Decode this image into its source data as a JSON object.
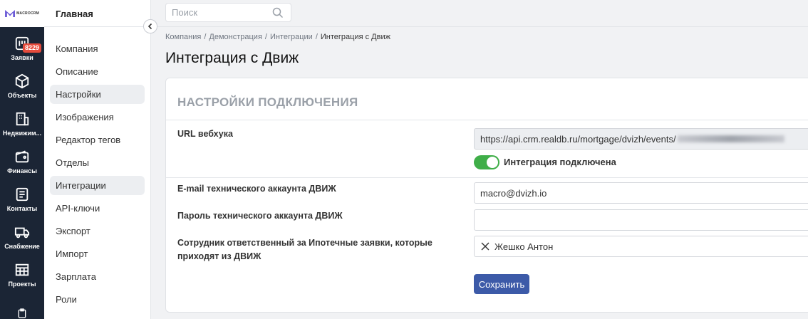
{
  "logo": {
    "text": "MACROCRM"
  },
  "rail": [
    {
      "label": "Заявки",
      "icon": "requests-icon",
      "badge": "8229"
    },
    {
      "label": "Объекты",
      "icon": "cube-icon"
    },
    {
      "label": "Недвижим...",
      "icon": "building-icon"
    },
    {
      "label": "Финансы",
      "icon": "wallet-icon"
    },
    {
      "label": "Контакты",
      "icon": "contacts-icon"
    },
    {
      "label": "Снабжение",
      "icon": "truck-icon"
    },
    {
      "label": "Проекты",
      "icon": "projects-icon"
    }
  ],
  "sidebar": {
    "title": "Главная",
    "items": [
      {
        "label": "Компания"
      },
      {
        "label": "Описание"
      },
      {
        "label": "Настройки",
        "active": true
      },
      {
        "label": "Изображения"
      },
      {
        "label": "Редактор тегов"
      },
      {
        "label": "Отделы"
      },
      {
        "label": "Интеграции",
        "active": true
      },
      {
        "label": "API-ключи"
      },
      {
        "label": "Экспорт"
      },
      {
        "label": "Импорт"
      },
      {
        "label": "Зарплата"
      },
      {
        "label": "Роли"
      }
    ]
  },
  "search": {
    "placeholder": "Поиск"
  },
  "breadcrumb": [
    "Компания",
    "Демонстрация",
    "Интеграции",
    "Интеграция с Движ"
  ],
  "page_title": "Интеграция с Движ",
  "section_title": "НАСТРОЙКИ ПОДКЛЮЧЕНИЯ",
  "form": {
    "webhook_label": "URL вебхука",
    "webhook_value": "https://api.crm.realdb.ru/mortgage/dvizh/events/",
    "toggle_label": "Интеграция подключена",
    "toggle_on": true,
    "email_label": "E-mail технического аккаунта ДВИЖ",
    "email_value": "macro@dvizh.io",
    "password_label": "Пароль технического аккаунта ДВИЖ",
    "password_value": "",
    "employee_label": "Сотрудник ответственный за Ипотечные заявки, которые приходят из ДВИЖ",
    "employee_value": "Жешко Антон",
    "save_label": "Сохранить"
  },
  "colors": {
    "rail_bg": "#1b2535",
    "accent": "#3c5aa8",
    "toggle_on": "#3fae48",
    "badge": "#e54b3c"
  }
}
